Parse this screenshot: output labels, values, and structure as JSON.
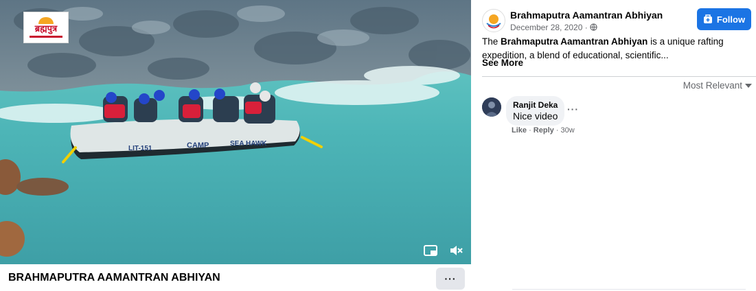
{
  "video": {
    "logo_text": "ब्रह्मपुत्र",
    "raft_text_left": "LIT-151",
    "raft_text_mid": "CAMP",
    "raft_text_right": "SEA HAWK",
    "controls": {
      "pip_icon": "picture-in-picture-icon",
      "mute_icon": "volume-muted-icon"
    }
  },
  "video_title": "BRAHMAPUTRA AAMANTRAN ABHIYAN",
  "more_label": "···",
  "post": {
    "page_name": "Brahmaputra Aamantran Abhiyan",
    "date": "December 28, 2020 ·",
    "follow_label": "Follow",
    "desc_prefix": "The ",
    "desc_bold": "Brahmaputra Aamantran Abhiyan",
    "desc_rest": " is a unique rafting expedition, a blend of educational, scientific...",
    "see_more": "See More"
  },
  "comments": {
    "sort_label": "Most Relevant",
    "items": [
      {
        "author": "Ranjit Deka",
        "text": "Nice video",
        "like": "Like",
        "reply": "Reply",
        "age": "30w",
        "more": "···"
      }
    ]
  },
  "colors": {
    "accent": "#1b74e4",
    "water": "#4fb5b8",
    "text": "#050505",
    "muted": "#65676b"
  }
}
